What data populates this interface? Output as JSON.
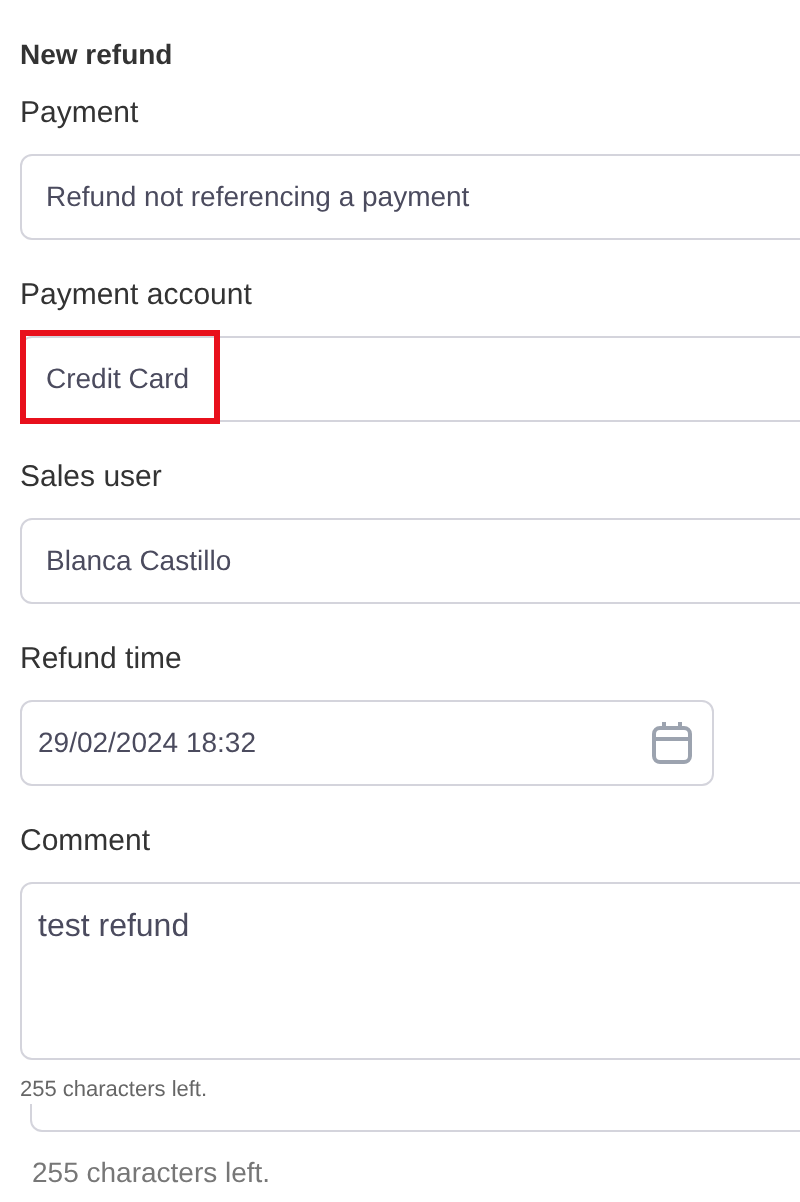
{
  "form": {
    "title": "New refund"
  },
  "fields": [
    {
      "kind": "select",
      "label": "Payment",
      "value": "Refund not referencing a payment",
      "highlighted": false
    },
    {
      "kind": "select",
      "label": "Payment account",
      "value": "Credit Card",
      "highlighted": true
    },
    {
      "kind": "select",
      "label": "Sales user",
      "value": "Blanca Castillo",
      "highlighted": false
    },
    {
      "kind": "date",
      "label": "Refund time",
      "value": "29/02/2024 18:32",
      "highlighted": false
    },
    {
      "kind": "textarea",
      "label": "Comment",
      "value": "test refund",
      "highlighted": false,
      "helper": "255 characters left."
    }
  ],
  "footer": {
    "helper": "255 characters left."
  }
}
